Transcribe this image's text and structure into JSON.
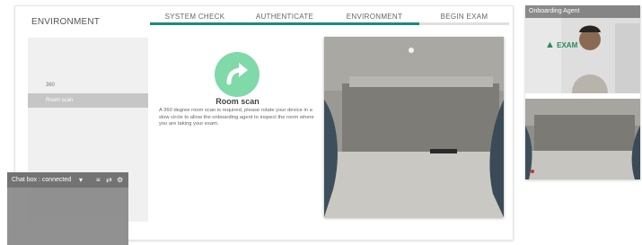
{
  "page": {
    "title": "ENVIRONMENT"
  },
  "steps": [
    {
      "label": "SYSTEM CHECK",
      "state": "done"
    },
    {
      "label": "AUTHENTICATE",
      "state": "done"
    },
    {
      "label": "ENVIRONMENT",
      "state": "current"
    },
    {
      "label": "BEGIN EXAM",
      "state": "pending"
    }
  ],
  "sidebar": {
    "items": [
      {
        "label": "360",
        "active": false
      },
      {
        "label": "Room scan",
        "active": true
      }
    ]
  },
  "room_scan": {
    "icon": "rotate-arrow-icon",
    "heading": "Room scan",
    "description": "A 360 degree room scan is required, please rotate your device in a slow circle to allow the onboarding agent to inspect the room where you are taking your exam."
  },
  "agent_panel": {
    "title": "Onboarding Agent",
    "logo_text": "EXAM"
  },
  "chat": {
    "status": "Chat box : connected"
  },
  "colors": {
    "accent": "#1a8a7a",
    "scan_icon_bg": "#7fd9a8",
    "active_item_bg": "#c6c6c6",
    "chat_bg": "#8d8d8d"
  }
}
